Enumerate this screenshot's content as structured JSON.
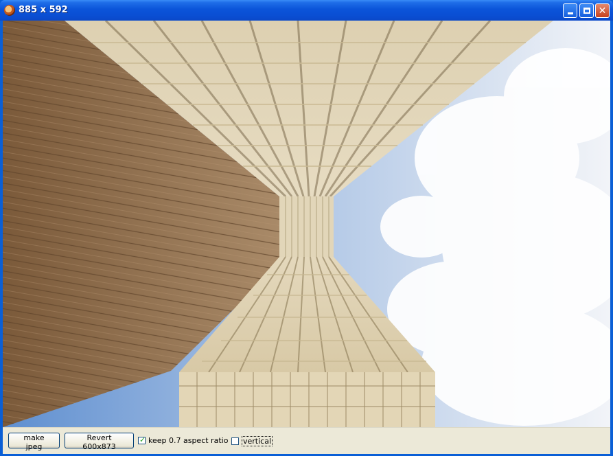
{
  "window": {
    "title": "885 x 592"
  },
  "toolbar": {
    "make_jpeg_label": "make jpeg",
    "revert_label": "Revert 600x873",
    "keep_aspect_label": "keep 0.7 aspect ratio",
    "keep_aspect_checked": true,
    "vertical_label": "vertical",
    "vertical_checked": false
  },
  "colors": {
    "title_blue": "#0a54d9",
    "wood": "#8c6a47",
    "brick": "#dccfb0",
    "sky": "#7fa6d8",
    "toolbar_bg": "#ece9d8"
  }
}
